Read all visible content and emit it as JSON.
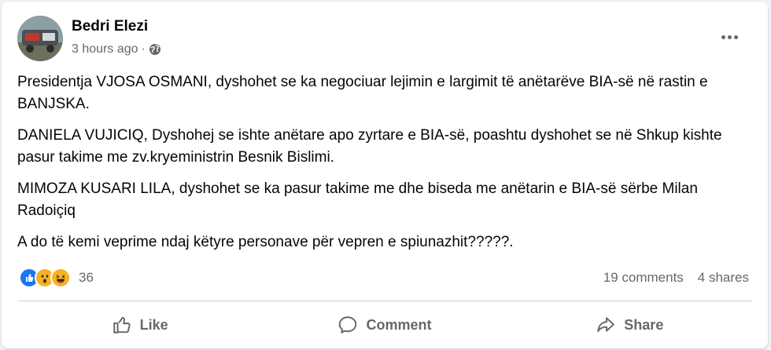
{
  "post": {
    "author": "Bedri Elezi",
    "time": "3 hours ago",
    "separator": "·",
    "audience_icon": "globe-icon",
    "more_icon": "more-options-icon",
    "paragraphs": [
      "Presidentja VJOSA OSMANI, dyshohet se ka negociuar lejimin e largimit të anëtarëve BIA-së në rastin e BANJSKA.",
      "DANIELA VUJICIQ, Dyshohej se ishte anëtare apo zyrtare e BIA-së, poashtu dyshohet se në Shkup kishte pasur takime me zv.kryeministrin  Besnik Bislimi.",
      "MIMOZA KUSARI LILA, dyshohet se ka pasur takime me dhe biseda me anëtarin e BIA-së sërbe Milan Radoiçiq",
      "A do të kemi veprime ndaj këtyre  personave për vepren e spiunazhit?????."
    ]
  },
  "engagement": {
    "reaction_icons": [
      "like-reaction-icon",
      "wow-reaction-icon",
      "haha-reaction-icon"
    ],
    "reaction_count": "36",
    "comments": "19 comments",
    "shares": "4 shares"
  },
  "actions": {
    "like": "Like",
    "comment": "Comment",
    "share": "Share"
  },
  "colors": {
    "accent": "#1877f2",
    "secondary_text": "#65676b",
    "reaction_yellow": "#f7b125"
  }
}
